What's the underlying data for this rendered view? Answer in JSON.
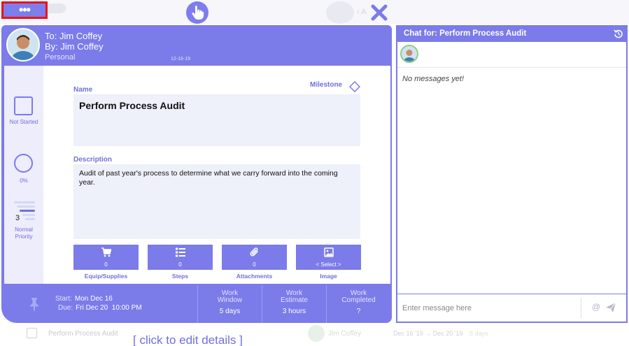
{
  "topbar": {
    "more_label": "•••"
  },
  "task": {
    "to_label": "To:",
    "to_name": "Jim Coffey",
    "by_label": "By:",
    "by_name": "Jim Coffey",
    "category": "Personal",
    "date": "12-16-19",
    "status_label": "Not Started",
    "progress_label": "0%",
    "priority_number": "3",
    "priority_label_1": "Normal",
    "priority_label_2": "Priority",
    "priority_level": 3,
    "priority_max": 5,
    "name_label": "Name",
    "name_value": "Perform Process Audit",
    "milestone_label": "Milestone",
    "description_label": "Description",
    "description_value": "Audit of past year's process to determine what we carry forward into the coming year.",
    "tiles": [
      {
        "label": "Equip/Supplies",
        "value": "0",
        "icon": "cart-icon"
      },
      {
        "label": "Steps",
        "value": "0",
        "icon": "list-icon"
      },
      {
        "label": "Attachments",
        "value": "0",
        "icon": "paperclip-icon"
      },
      {
        "label": "Image",
        "value": "< Select >",
        "icon": "image-icon"
      }
    ]
  },
  "footer": {
    "start_label": "Start:",
    "start_value": "Mon Dec 16",
    "due_label": "Due:",
    "due_value": "Fri Dec 20  10:00 PM",
    "metrics": [
      {
        "label_1": "Work",
        "label_2": "Window",
        "value": "5 days"
      },
      {
        "label_1": "Work",
        "label_2": "Estimate",
        "value": "3 hours"
      },
      {
        "label_1": "Work",
        "label_2": "Completed",
        "value": "?"
      }
    ]
  },
  "chat": {
    "title": "Chat for: Perform Process Audit",
    "empty_text": "No messages yet!",
    "input_placeholder": "Enter message here",
    "at_symbol": "@"
  },
  "background": {
    "task_name": "Perform Process Audit",
    "user_name": "Jim Coffey",
    "dates": "Dec 16 '19  →  Dec 20 '19",
    "days": "5 days",
    "edit_link": "[ click to edit details ]"
  },
  "colors": {
    "accent": "#7b7bea",
    "accent_text": "#6f6fe0",
    "field_bg": "#eef0fa",
    "highlight_border": "#ee1111"
  }
}
